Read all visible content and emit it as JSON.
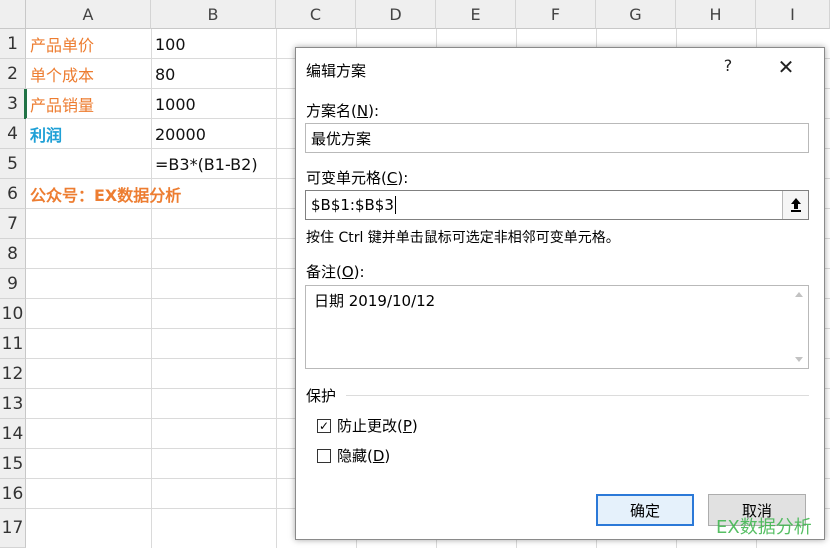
{
  "columns": [
    "A",
    "B",
    "C",
    "D",
    "E",
    "F",
    "G",
    "H",
    "I"
  ],
  "rows": [
    "1",
    "2",
    "3",
    "4",
    "5",
    "6",
    "7",
    "8",
    "9",
    "10",
    "11",
    "12",
    "13",
    "14",
    "15",
    "16",
    "17"
  ],
  "cells": {
    "a1": "产品单价",
    "b1": "100",
    "a2": "单个成本",
    "b2": "80",
    "a3": "产品销量",
    "b3": "1000",
    "a4": "利润",
    "b4": "20000",
    "b5": "=B3*(B1-B2)",
    "a6": "公众号：EX数据分析"
  },
  "dialog": {
    "title": "编辑方案",
    "help": "?",
    "close": "✕",
    "scenario_name_label": "方案名(",
    "scenario_name_key": "N",
    "scenario_name_suffix": "):",
    "scenario_name_value": "最优方案",
    "changing_cells_label": "可变单元格(",
    "changing_cells_key": "C",
    "changing_cells_suffix": "):",
    "changing_cells_value": "$B$1:$B$3",
    "hint": "按住 Ctrl 键并单击鼠标可选定非相邻可变单元格。",
    "comment_label": "备注(",
    "comment_key": "O",
    "comment_suffix": "):",
    "comment_value": "日期 2019/10/12",
    "protection_label": "保护",
    "prevent_changes_label": "防止更改(",
    "prevent_changes_key": "P",
    "prevent_changes_suffix": ")",
    "prevent_changes_checked": true,
    "hide_label": "隐藏(",
    "hide_key": "D",
    "hide_suffix": ")",
    "hide_checked": false,
    "ok_label": "确定",
    "cancel_label": "取消"
  },
  "watermark": "EX数据分析",
  "colors": {
    "orange": "#ed7d31",
    "blue": "#1fa0d6",
    "accent": "#2b79d8",
    "watermark": "#3ab54a"
  }
}
